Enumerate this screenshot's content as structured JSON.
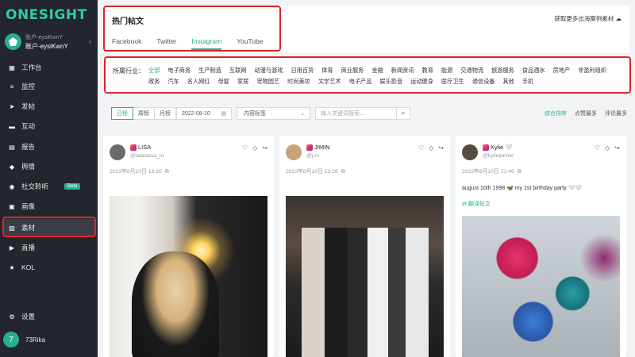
{
  "app": {
    "logo": "ONESIGHT"
  },
  "account": {
    "sub": "账户-eysiKwnY",
    "name": "账户-eysiKwnY"
  },
  "nav": [
    {
      "label": "工作台",
      "icon": "dashboard-icon"
    },
    {
      "label": "监控",
      "icon": "monitor-icon"
    },
    {
      "label": "发帖",
      "icon": "send-icon"
    },
    {
      "label": "互动",
      "icon": "chat-icon"
    },
    {
      "label": "报告",
      "icon": "report-icon"
    },
    {
      "label": "舆情",
      "icon": "sentiment-icon"
    },
    {
      "label": "社交聆听",
      "icon": "listening-icon",
      "badge": "Beta"
    },
    {
      "label": "画像",
      "icon": "portrait-icon"
    },
    {
      "label": "素材",
      "icon": "material-icon",
      "active": true
    },
    {
      "label": "直播",
      "icon": "live-icon"
    },
    {
      "label": "KOL",
      "icon": "star-icon"
    }
  ],
  "settings": {
    "label": "设置"
  },
  "user": {
    "initial": "7",
    "name": "73Rika"
  },
  "top": {
    "title": "热门帖文",
    "link": "获取更多出海案例素材",
    "tabs": [
      "Facebook",
      "Twitter",
      "Instagram",
      "YouTube"
    ],
    "active_tab": "Instagram"
  },
  "industry": {
    "label": "所属行业：",
    "row1": [
      "全部",
      "电子商务",
      "生产制造",
      "互联网",
      "动漫与游戏",
      "日用百货",
      "体育",
      "商业服务",
      "金融",
      "新闻资讯",
      "教育",
      "能源",
      "交通物流",
      "旅游服务",
      "食品酒水",
      "房地产",
      "非盈利组织"
    ],
    "row2": [
      "政务",
      "汽车",
      "名人网红",
      "母婴",
      "家居",
      "宠物园艺",
      "时尚美妆",
      "文学艺术",
      "电子产品",
      "娱乐影音",
      "运动健身",
      "医疗卫生",
      "通信设备",
      "其他",
      "手机"
    ],
    "selected": "全部"
  },
  "filters": {
    "periods": [
      "日榜",
      "周榜",
      "月榜"
    ],
    "selected_period": "日榜",
    "date": "2022-08-10",
    "content_type": "内容标签",
    "search_placeholder": "输入关键词搜索...",
    "sorts": [
      "综合排序",
      "点赞最多",
      "评论最多"
    ],
    "selected_sort": "综合排序"
  },
  "posts": [
    {
      "name": "LISA",
      "handle": "@lalalalisa_m",
      "date": "2022年8月10日 18:20"
    },
    {
      "name": "JIMIN",
      "handle": "@j.m",
      "date": "2022年8月10日 13:26"
    },
    {
      "name": "Kylie",
      "handle": "@kyliejenner",
      "date": "2022年8月10日 21:46",
      "caption": "august 10th 1998 🦋 my 1st birthday party 🤍🤍",
      "translate": "翻译帖文"
    }
  ],
  "colors": {
    "accent": "#2ab08f",
    "sidebar": "#24262d",
    "highlight": "#e0242a"
  }
}
